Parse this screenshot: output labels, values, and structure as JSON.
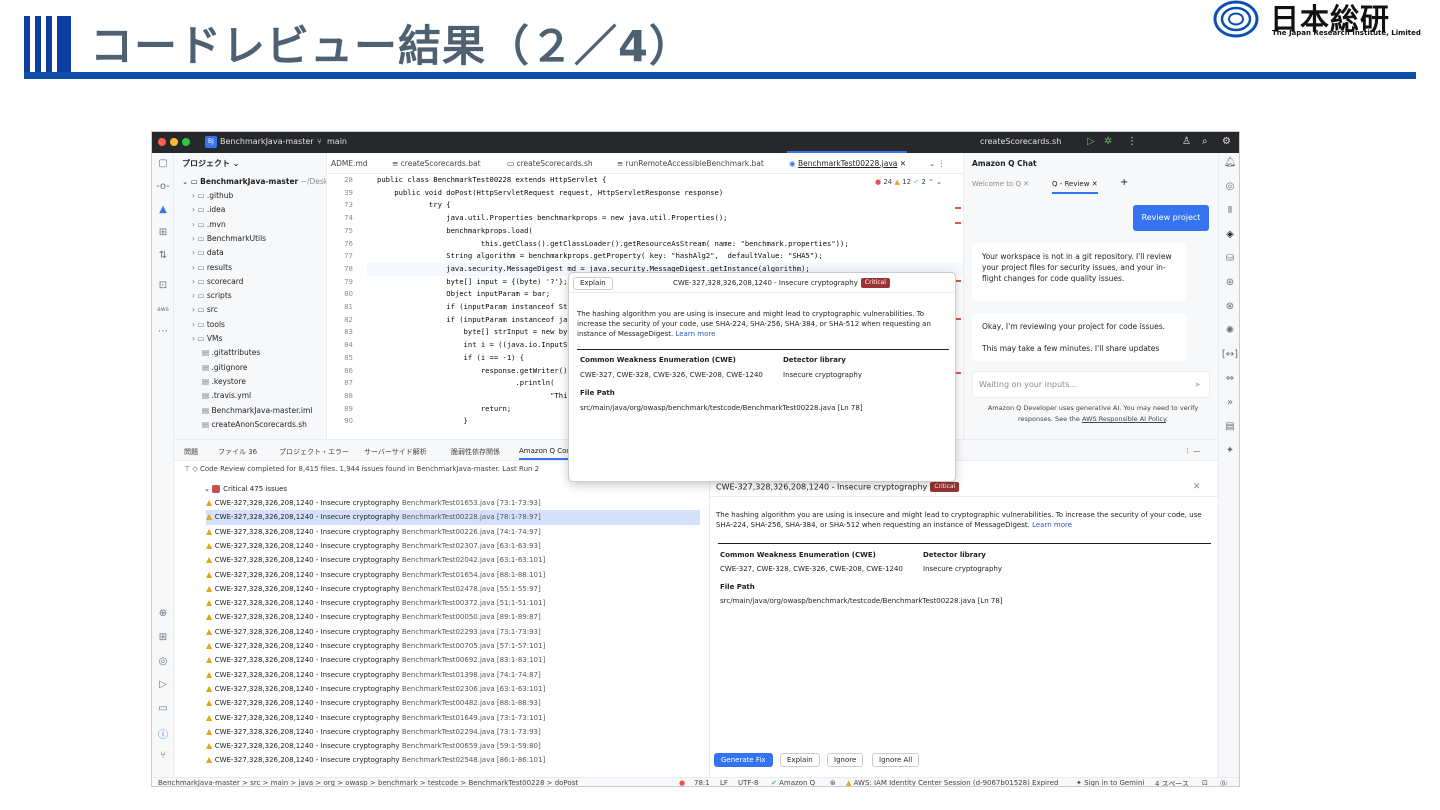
{
  "slide": {
    "title": "コードレビュー結果（２／4）"
  },
  "logo": {
    "kanji": "日本総研",
    "english": "The Japan Research Institute, Limited"
  },
  "titlebar": {
    "project": "BenchmarkJava-master",
    "branch": "main",
    "run_config": "createScorecards.sh"
  },
  "project_panel": {
    "title": "プロジェクト",
    "root": "BenchmarkJava-master",
    "root_path": "~/Deskt",
    "items": [
      ".github",
      ".idea",
      ".mvn",
      "BenchmarkUtils",
      "data",
      "results",
      "scorecard",
      "scripts",
      "src",
      "tools",
      "VMs",
      ".gitattributes",
      ".gitignore",
      ".keystore",
      ".travis.yml",
      "BenchmarkJava-master.iml",
      "createAnonScorecards.sh"
    ]
  },
  "editor": {
    "tabs": [
      "ADME.md",
      "createScorecards.bat",
      "createScorecards.sh",
      "runRemoteAccessibleBenchmark.bat",
      "BenchmarkTest00228.java"
    ],
    "inspections": {
      "errors": "24",
      "warnings": "12",
      "weak": "2"
    },
    "lines": [
      {
        "n": "28",
        "code": "public class BenchmarkTest00228 extends HttpServlet {"
      },
      {
        "n": "39",
        "code": "    public void doPost(HttpServletRequest request, HttpServletResponse response)"
      },
      {
        "n": "73",
        "code": "            try {"
      },
      {
        "n": "74",
        "code": "                java.util.Properties benchmarkprops = new java.util.Properties();"
      },
      {
        "n": "75",
        "code": "                benchmarkprops.load("
      },
      {
        "n": "76",
        "code": "                        this.getClass().getClassLoader().getResourceAsStream( name: \"benchmark.properties\"));"
      },
      {
        "n": "77",
        "code": "                String algorithm = benchmarkprops.getProperty( key: \"hashAlg2\",  defaultValue: \"SHA5\");"
      },
      {
        "n": "78",
        "code": "                java.security.MessageDigest md = java.security.MessageDigest.getInstance(algorithm);"
      },
      {
        "n": "79",
        "code": "                byte[] input = {(byte) '?'};"
      },
      {
        "n": "80",
        "code": "                Object inputParam = bar;"
      },
      {
        "n": "81",
        "code": "                if (inputParam instanceof Stri"
      },
      {
        "n": "82",
        "code": "                if (inputParam instanceof java"
      },
      {
        "n": "83",
        "code": "                    byte[] strInput = new byte"
      },
      {
        "n": "84",
        "code": "                    int i = ((java.io.InputStr"
      },
      {
        "n": "85",
        "code": "                    if (i == -1) {"
      },
      {
        "n": "86",
        "code": "                        response.getWriter()"
      },
      {
        "n": "87",
        "code": "                                .println("
      },
      {
        "n": "88",
        "code": "                                        \"This"
      },
      {
        "n": "89",
        "code": "                        return;"
      },
      {
        "n": "90",
        "code": "                    }"
      }
    ]
  },
  "amazon_q": {
    "panel_title": "Amazon Q Chat",
    "tabs": [
      "Welcome to Q",
      "Q - Review"
    ],
    "review_button": "Review project",
    "msg1": "Your workspace is not in a git repository. I'll review your project files for security issues, and your in-flight changes for code quality issues.",
    "msg2a": "Okay, I'm reviewing your project for code issues.",
    "msg2b": "This may take a few minutes. I'll share updates",
    "input_placeholder": "Waiting on your inputs...",
    "disclaimer_a": "Amazon Q Developer uses generative AI. You may need to verify responses. See the",
    "disclaimer_link": "AWS Responsible AI Policy",
    "disclaimer_b": "."
  },
  "tool_tabs": [
    "問題",
    "ファイル 36",
    "プロジェクト・エラー",
    "サーバーサイド解析",
    "脆弱性依存関係",
    "Amazon Q Code"
  ],
  "findings": {
    "summary": "Code Review completed for 8,415 files. 1,944 issues found in BenchmarkJava-master. Last Run 2",
    "group": "Critical 475 issues",
    "items": [
      {
        "title": "CWE-327,328,326,208,1240 - Insecure cryptography",
        "loc": "BenchmarkTest01653.java [73:1-73:93]"
      },
      {
        "title": "CWE-327,328,326,208,1240 - Insecure cryptography",
        "loc": "BenchmarkTest00228.java [78:1-78:97]"
      },
      {
        "title": "CWE-327,328,326,208,1240 - Insecure cryptography",
        "loc": "BenchmarkTest00226.java [74:1-74:97]"
      },
      {
        "title": "CWE-327,328,326,208,1240 - Insecure cryptography",
        "loc": "BenchmarkTest02307.java [63:1-63:93]"
      },
      {
        "title": "CWE-327,328,326,208,1240 - Insecure cryptography",
        "loc": "BenchmarkTest02042.java [63:1-63:101]"
      },
      {
        "title": "CWE-327,328,326,208,1240 - Insecure cryptography",
        "loc": "BenchmarkTest01654.java [88:1-88:101]"
      },
      {
        "title": "CWE-327,328,326,208,1240 - Insecure cryptography",
        "loc": "BenchmarkTest02478.java [55:1-55:97]"
      },
      {
        "title": "CWE-327,328,326,208,1240 - Insecure cryptography",
        "loc": "BenchmarkTest00372.java [51:1-51:101]"
      },
      {
        "title": "CWE-327,328,326,208,1240 - Insecure cryptography",
        "loc": "BenchmarkTest00050.java [89:1-89:87]"
      },
      {
        "title": "CWE-327,328,326,208,1240 - Insecure cryptography",
        "loc": "BenchmarkTest02293.java [73:1-73:93]"
      },
      {
        "title": "CWE-327,328,326,208,1240 - Insecure cryptography",
        "loc": "BenchmarkTest00705.java [57:1-57:101]"
      },
      {
        "title": "CWE-327,328,326,208,1240 - Insecure cryptography",
        "loc": "BenchmarkTest00692.java [83:1-83:101]"
      },
      {
        "title": "CWE-327,328,326,208,1240 - Insecure cryptography",
        "loc": "BenchmarkTest01398.java [74:1-74:87]"
      },
      {
        "title": "CWE-327,328,326,208,1240 - Insecure cryptography",
        "loc": "BenchmarkTest02306.java [63:1-63:101]"
      },
      {
        "title": "CWE-327,328,326,208,1240 - Insecure cryptography",
        "loc": "BenchmarkTest00482.java [88:1-88:93]"
      },
      {
        "title": "CWE-327,328,326,208,1240 - Insecure cryptography",
        "loc": "BenchmarkTest01649.java [73:1-73:101]"
      },
      {
        "title": "CWE-327,328,326,208,1240 - Insecure cryptography",
        "loc": "BenchmarkTest02294.java [73:1-73:93]"
      },
      {
        "title": "CWE-327,328,326,208,1240 - Insecure cryptography",
        "loc": "BenchmarkTest00659.java [59:1-59:80]"
      },
      {
        "title": "CWE-327,328,326,208,1240 - Insecure cryptography",
        "loc": "BenchmarkTest02548.java [86:1-86:101]"
      }
    ]
  },
  "detail": {
    "title": "CWE-327,328,326,208,1240 - Insecure cryptography",
    "severity": "Critical",
    "description": "The hashing algorithm you are using is insecure and might lead to cryptographic vulnerabilities. To increase the security of your code, use SHA-224, SHA-256, SHA-384, or SHA-512 when requesting an instance of MessageDigest.",
    "learn_more": "Learn more",
    "cwe_header": "Common Weakness Enumeration (CWE)",
    "detector_header": "Detector library",
    "cwe_links": "CWE-327, CWE-328, CWE-326, CWE-208, CWE-1240",
    "detector": "Insecure cryptography",
    "file_path_header": "File Path",
    "file_path": "src/main/java/org/owasp/benchmark/testcode/BenchmarkTest00228.java [Ln 78]",
    "buttons": [
      "Generate Fix",
      "Explain",
      "Ignore",
      "Ignore All"
    ]
  },
  "popup": {
    "explain": "Explain",
    "title": "CWE-327,328,326,208,1240 - Insecure cryptography",
    "severity": "Critical",
    "description": "The hashing algorithm you are using is insecure and might lead to cryptographic vulnerabilities. To increase the security of your code, use SHA-224, SHA-256, SHA-384, or SHA-512 when requesting an instance of MessageDigest.",
    "learn_more": "Learn more",
    "cwe_header": "Common Weakness Enumeration (CWE)",
    "detector_header": "Detector library",
    "cwe_links": "CWE-327, CWE-328, CWE-326, CWE-208, CWE-1240",
    "detector": "Insecure cryptography",
    "file_path_header": "File Path",
    "file_path": "src/main/java/org/owasp/benchmark/testcode/BenchmarkTest00228.java [Ln 78]"
  },
  "statusbar": {
    "breadcrumb": "BenchmarkJava-master > src > main > java > org > owasp > benchmark > testcode > BenchmarkTest00228 > doPost",
    "position": "78:1",
    "line_sep": "LF",
    "encoding": "UTF-8",
    "amazon_q": "Amazon Q",
    "aws": "AWS: IAM Identity Center Session (d-9067b01528) Expired",
    "signin": "Sign in to Gemini",
    "indent": "4 スペース"
  },
  "colors": {
    "accent": "#3574f0",
    "title_bar": "#0b3ea0",
    "critical": "#9c3333"
  }
}
